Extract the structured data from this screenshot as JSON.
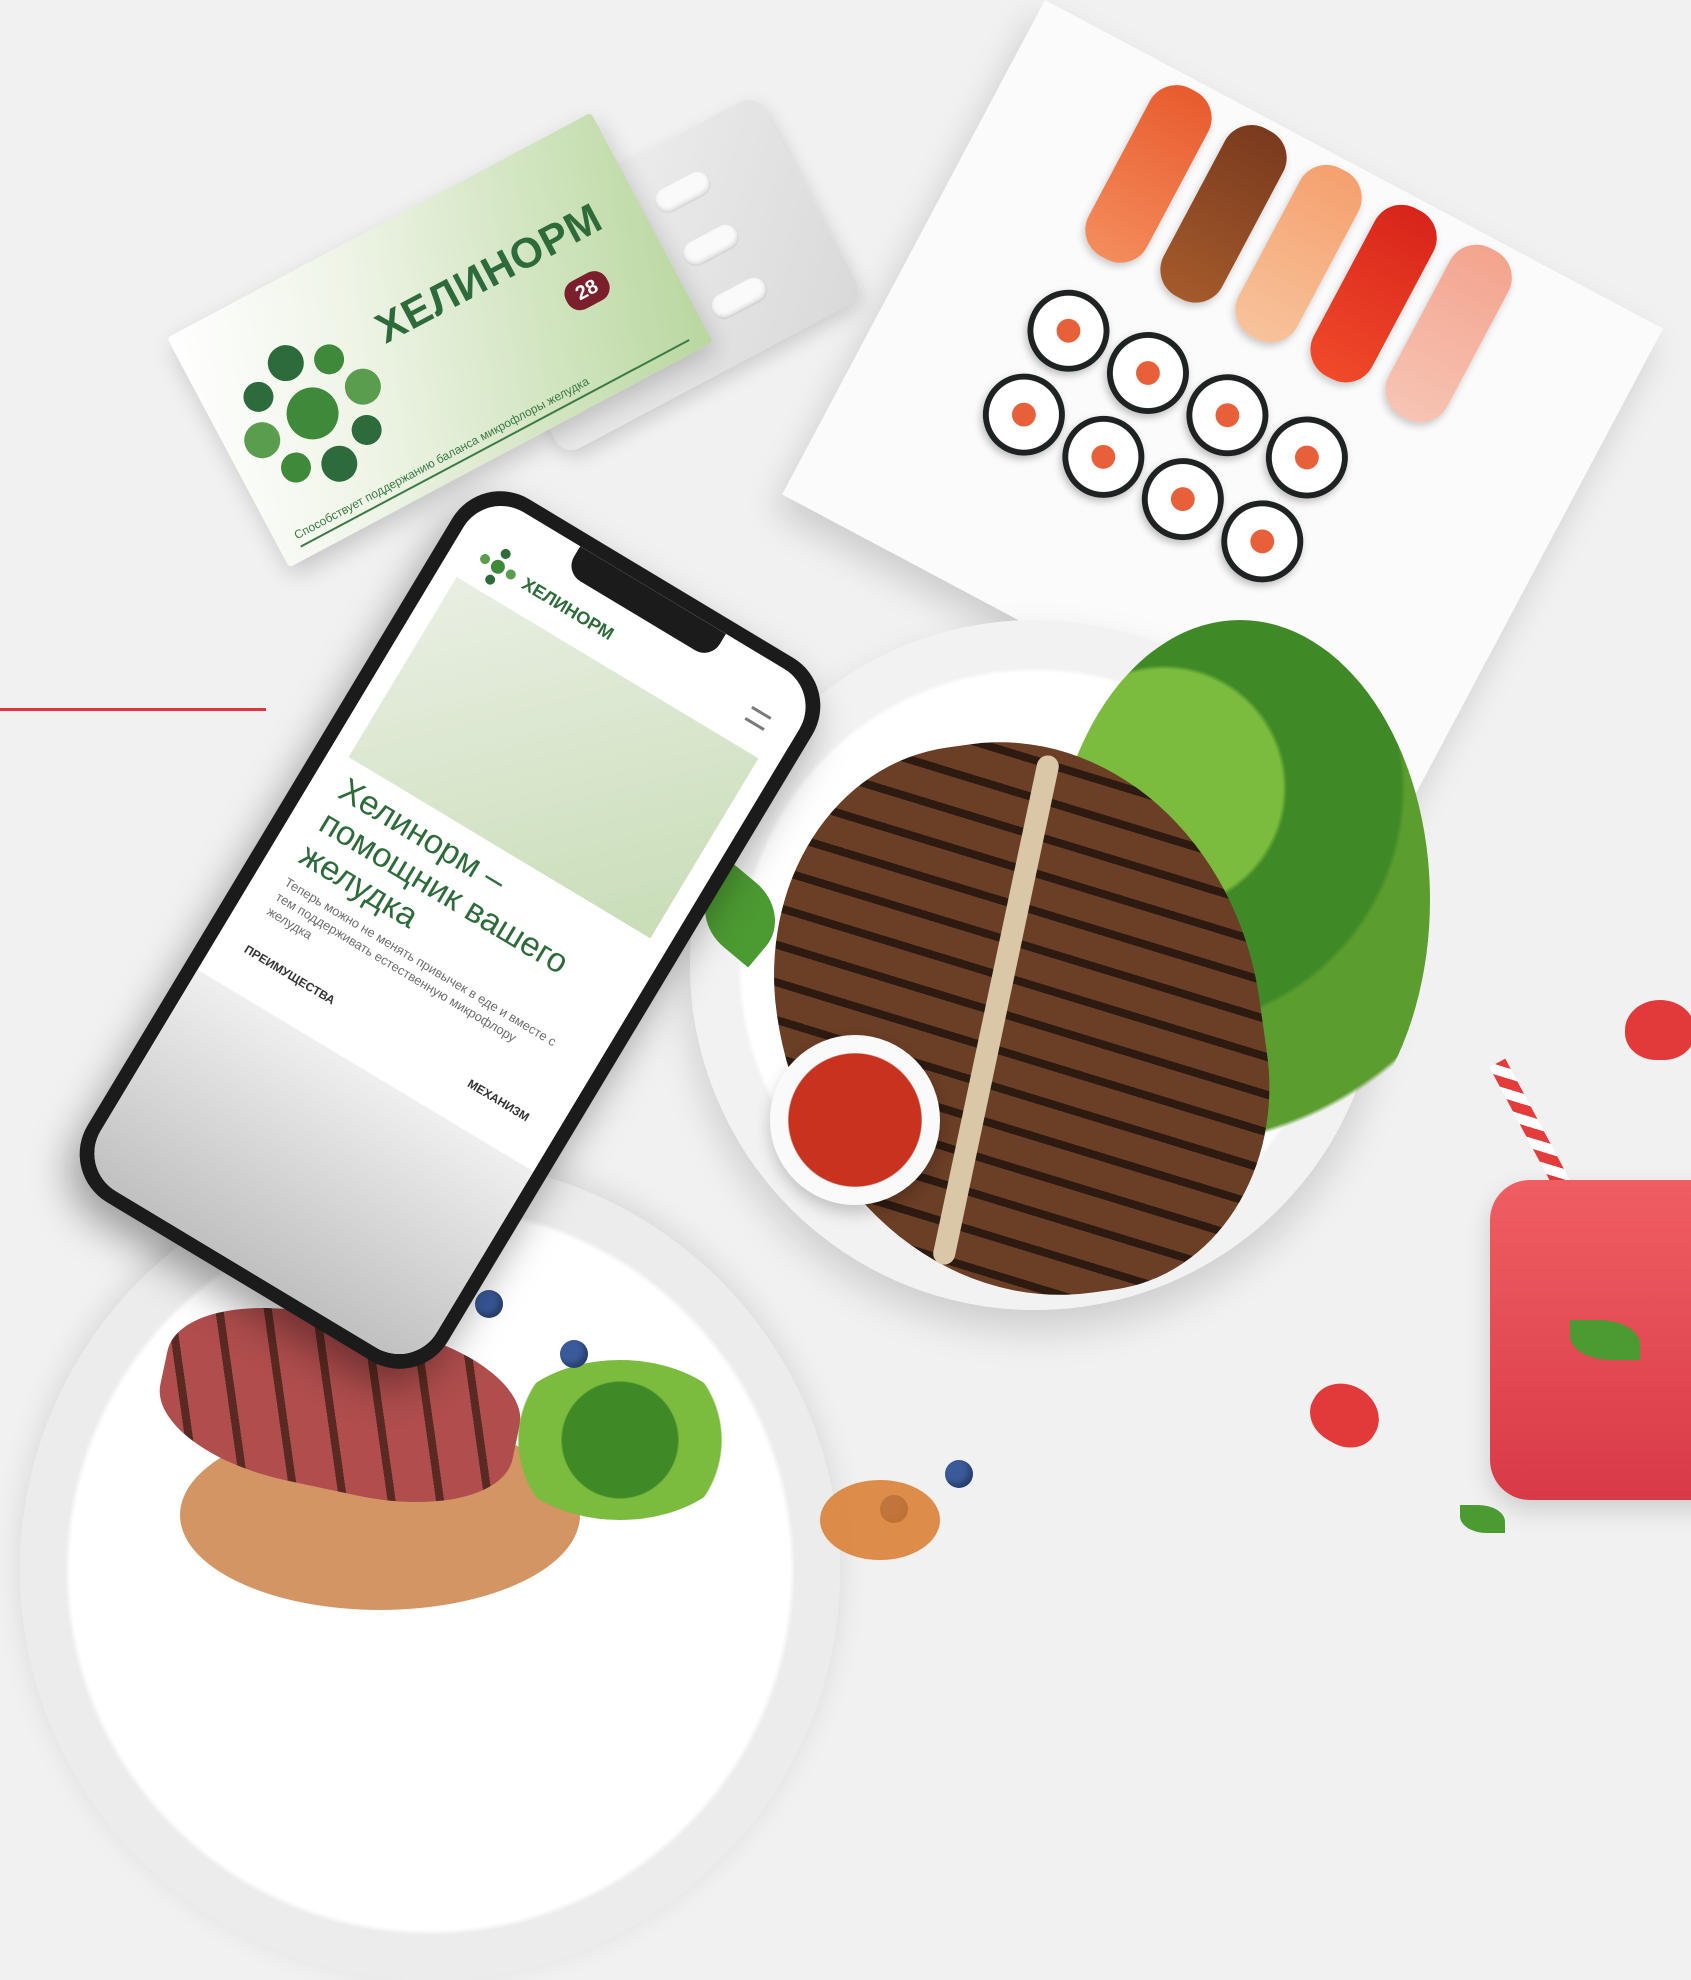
{
  "product": {
    "brand": "ХЕЛИНОРМ",
    "badge": "28",
    "tagline": "Способствует поддержанию баланса микрофлоры желудка"
  },
  "phone_site": {
    "brand": "ХЕЛИНОРМ",
    "title": "Хелинорм – помощник вашего желудка",
    "description": "Теперь можно не менять привычек в еде и вместе с тем поддерживать естественную микрофлору желудка",
    "nav_prev": "ПРЕИМУЩЕСТВА",
    "nav_next": "МЕХАНИЗМ"
  },
  "colors": {
    "accent_line": "#e0353c",
    "brand_green": "#2e6b3a",
    "background": "#f1f1f2"
  }
}
